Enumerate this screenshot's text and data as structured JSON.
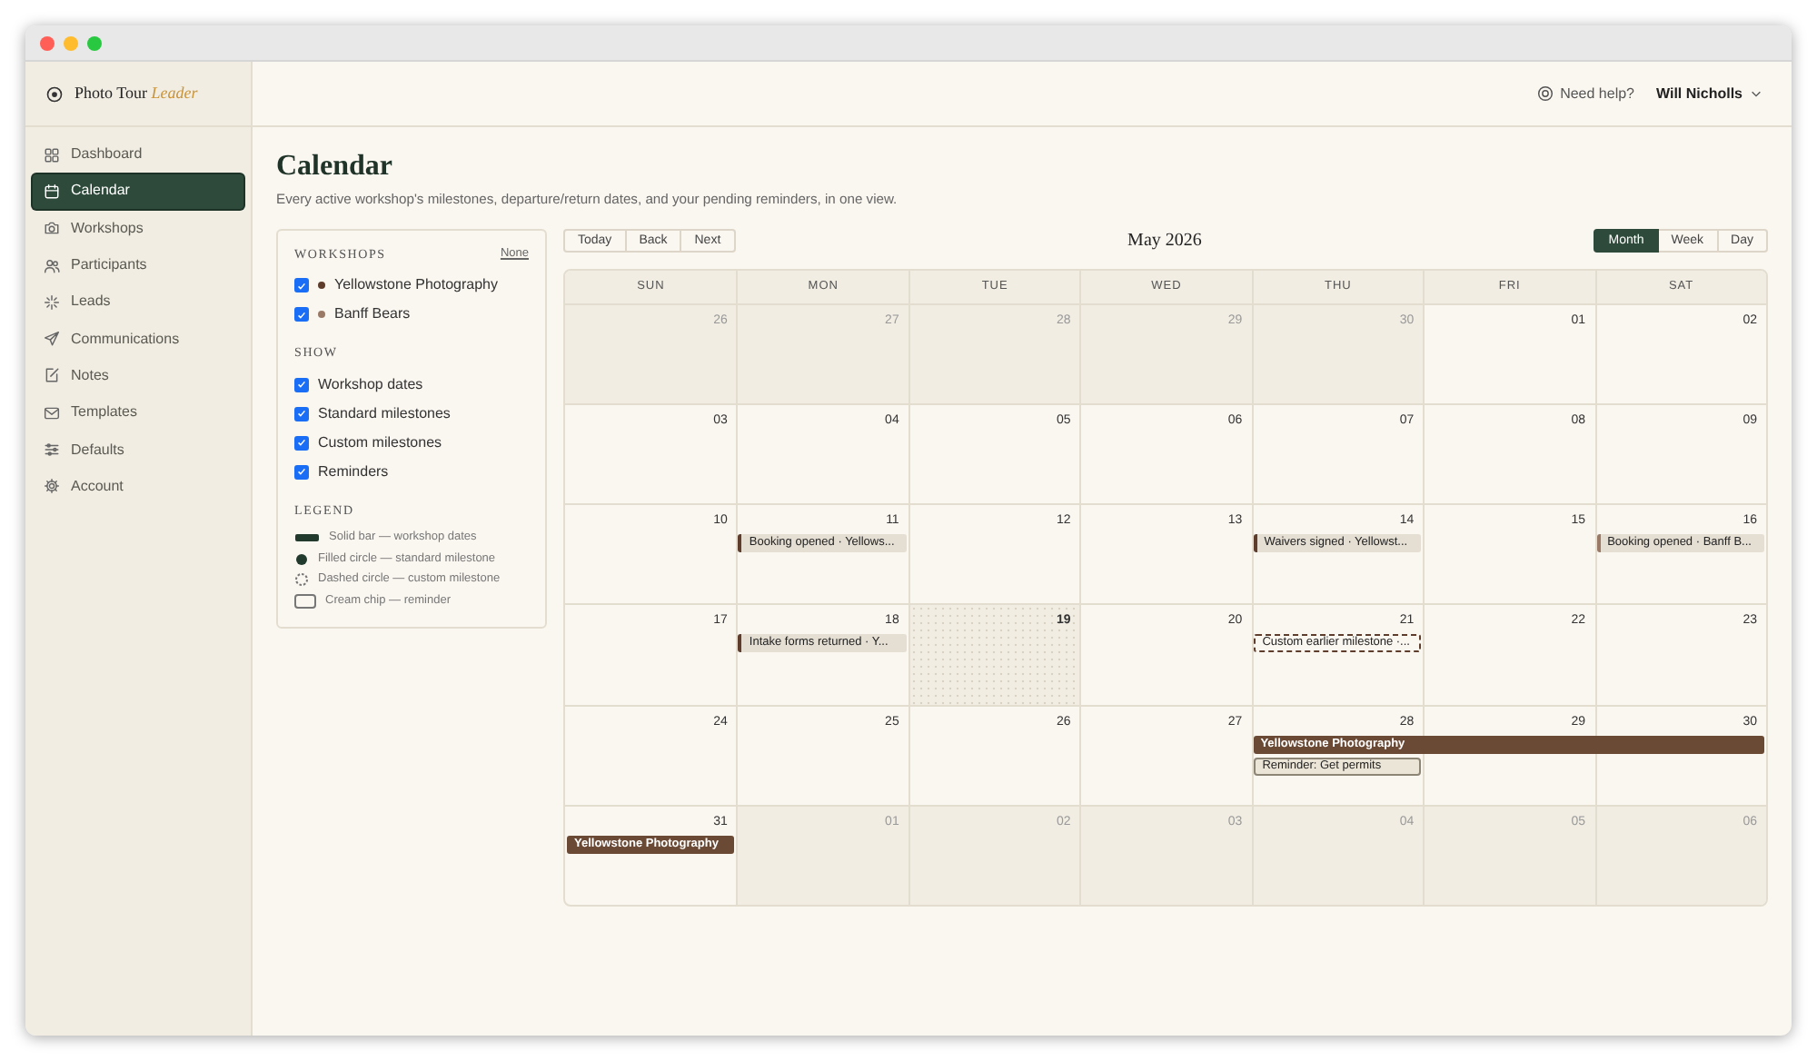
{
  "window": {
    "controls": [
      {
        "color": "#ff5f57"
      },
      {
        "color": "#febc2e"
      },
      {
        "color": "#28c840"
      }
    ]
  },
  "brand": {
    "name": "Photo Tour",
    "accent": "Leader"
  },
  "sidebar": {
    "items": [
      {
        "label": "Dashboard",
        "selected": false
      },
      {
        "label": "Calendar",
        "selected": true
      },
      {
        "label": "Workshops",
        "selected": false
      },
      {
        "label": "Participants",
        "selected": false
      },
      {
        "label": "Leads",
        "selected": false
      },
      {
        "label": "Communications",
        "selected": false
      },
      {
        "label": "Notes",
        "selected": false
      },
      {
        "label": "Templates",
        "selected": false
      },
      {
        "label": "Defaults",
        "selected": false
      },
      {
        "label": "Account",
        "selected": false
      }
    ]
  },
  "header": {
    "help": "Need help?",
    "user": "Will Nicholls"
  },
  "page": {
    "title": "Calendar",
    "subtitle": "Every active workshop's milestones, departure/return dates, and your pending reminders, in one view."
  },
  "filters": {
    "workshops_heading": "WORKSHOPS",
    "none_link": "None",
    "workshops": [
      {
        "label": "Yellowstone Photography",
        "checked": true,
        "color": "#5e3d2c"
      },
      {
        "label": "Banff Bears",
        "checked": true,
        "color": "#9a7a66"
      }
    ],
    "show_heading": "SHOW",
    "show": [
      {
        "label": "Workshop dates",
        "checked": true
      },
      {
        "label": "Standard milestones",
        "checked": true
      },
      {
        "label": "Custom milestones",
        "checked": true
      },
      {
        "label": "Reminders",
        "checked": true
      }
    ],
    "legend_heading": "LEGEND",
    "legend": [
      {
        "kind": "bar",
        "label": "Solid bar — workshop dates"
      },
      {
        "kind": "filled",
        "label": "Filled circle — standard milestone"
      },
      {
        "kind": "dashed",
        "label": "Dashed circle — custom milestone"
      },
      {
        "kind": "chip",
        "label": "Cream chip — reminder"
      }
    ]
  },
  "toolbar": {
    "nav": [
      "Today",
      "Back",
      "Next"
    ],
    "title": "May 2026",
    "views": [
      {
        "label": "Month",
        "selected": true
      },
      {
        "label": "Week",
        "selected": false
      },
      {
        "label": "Day",
        "selected": false
      }
    ]
  },
  "calendar": {
    "weekdays": [
      "SUN",
      "MON",
      "TUE",
      "WED",
      "THU",
      "FRI",
      "SAT"
    ],
    "weeks": [
      {
        "days": [
          {
            "number": "26",
            "muted": true,
            "today": false
          },
          {
            "number": "27",
            "muted": true,
            "today": false
          },
          {
            "number": "28",
            "muted": true,
            "today": false
          },
          {
            "number": "29",
            "muted": true,
            "today": false
          },
          {
            "number": "30",
            "muted": true,
            "today": false
          },
          {
            "number": "01",
            "muted": false,
            "today": false
          },
          {
            "number": "02",
            "muted": false,
            "today": false
          }
        ]
      },
      {
        "days": [
          {
            "number": "03",
            "muted": false,
            "today": false
          },
          {
            "number": "04",
            "muted": false,
            "today": false
          },
          {
            "number": "05",
            "muted": false,
            "today": false
          },
          {
            "number": "06",
            "muted": false,
            "today": false
          },
          {
            "number": "07",
            "muted": false,
            "today": false
          },
          {
            "number": "08",
            "muted": false,
            "today": false
          },
          {
            "number": "09",
            "muted": false,
            "today": false
          }
        ]
      },
      {
        "days": [
          {
            "number": "10",
            "muted": false,
            "today": false
          },
          {
            "number": "11",
            "muted": false,
            "today": false,
            "events": [
              {
                "kind": "milestone",
                "label": "Booking opened · Yellows...",
                "color": "#5e3d2c"
              }
            ]
          },
          {
            "number": "12",
            "muted": false,
            "today": false
          },
          {
            "number": "13",
            "muted": false,
            "today": false
          },
          {
            "number": "14",
            "muted": false,
            "today": false,
            "events": [
              {
                "kind": "milestone",
                "label": "Waivers signed · Yellowst...",
                "color": "#5e3d2c"
              }
            ]
          },
          {
            "number": "15",
            "muted": false,
            "today": false
          },
          {
            "number": "16",
            "muted": false,
            "today": false,
            "events": [
              {
                "kind": "milestone",
                "label": "Booking opened · Banff B...",
                "color": "#9a7a66"
              }
            ]
          }
        ]
      },
      {
        "days": [
          {
            "number": "17",
            "muted": false,
            "today": false
          },
          {
            "number": "18",
            "muted": false,
            "today": false,
            "events": [
              {
                "kind": "milestone",
                "label": "Intake forms returned · Y...",
                "color": "#5e3d2c"
              }
            ]
          },
          {
            "number": "19",
            "muted": false,
            "today": true
          },
          {
            "number": "20",
            "muted": false,
            "today": false
          },
          {
            "number": "21",
            "muted": false,
            "today": false,
            "events": [
              {
                "kind": "custom",
                "label": "Custom earlier milestone ·...",
                "color": "#5e3d2c"
              }
            ]
          },
          {
            "number": "22",
            "muted": false,
            "today": false
          },
          {
            "number": "23",
            "muted": false,
            "today": false
          }
        ]
      },
      {
        "days": [
          {
            "number": "24",
            "muted": false,
            "today": false
          },
          {
            "number": "25",
            "muted": false,
            "today": false
          },
          {
            "number": "26",
            "muted": false,
            "today": false
          },
          {
            "number": "27",
            "muted": false,
            "today": false
          },
          {
            "number": "28",
            "muted": false,
            "today": false,
            "events": [
              {
                "kind": "bar",
                "label": "Yellowstone Photography",
                "color": "#6b4a35"
              },
              {
                "kind": "reminder",
                "label": "Reminder: Get permits",
                "color": "#8c8474"
              }
            ]
          },
          {
            "number": "29",
            "muted": false,
            "today": false,
            "events": [
              {
                "kind": "bar_continued",
                "color": "#6b4a35"
              }
            ]
          },
          {
            "number": "30",
            "muted": false,
            "today": false,
            "events": [
              {
                "kind": "bar_continued",
                "color": "#6b4a35"
              }
            ]
          }
        ]
      },
      {
        "days": [
          {
            "number": "31",
            "muted": false,
            "today": false,
            "events": [
              {
                "kind": "bar",
                "label": "Yellowstone Photography",
                "color": "#6b4a35"
              }
            ]
          },
          {
            "number": "01",
            "muted": true,
            "today": false
          },
          {
            "number": "02",
            "muted": true,
            "today": false
          },
          {
            "number": "03",
            "muted": true,
            "today": false
          },
          {
            "number": "04",
            "muted": true,
            "today": false
          },
          {
            "number": "05",
            "muted": true,
            "today": false
          },
          {
            "number": "06",
            "muted": true,
            "today": false
          }
        ]
      }
    ]
  }
}
